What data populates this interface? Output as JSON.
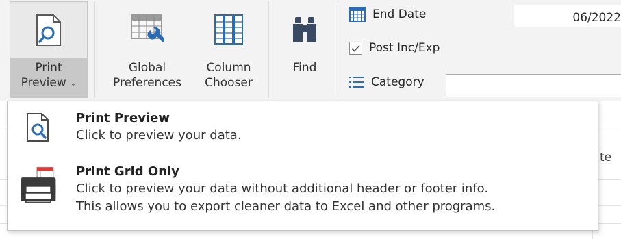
{
  "ribbon": {
    "print_preview": {
      "line1": "Print",
      "line2": "Preview",
      "chevron": "⌄"
    },
    "global_preferences": {
      "line1": "Global",
      "line2": "Preferences"
    },
    "column_chooser": {
      "line1": "Column",
      "line2": "Chooser"
    },
    "find": {
      "label": "Find"
    },
    "end_date": {
      "label": "End Date",
      "value": "06/2022"
    },
    "post_inc_exp": {
      "label": "Post Inc/Exp",
      "checked": true
    },
    "category": {
      "label": "Category",
      "value": ""
    }
  },
  "grid": {
    "header_fragment": "te"
  },
  "dropdown": {
    "items": [
      {
        "title": "Print Preview",
        "desc": [
          "Click to preview your data."
        ],
        "icon": "print-preview-icon"
      },
      {
        "title": "Print Grid Only",
        "desc": [
          "Click to preview your data without additional header or footer info.",
          "This allows you to export cleaner data to Excel and other programs."
        ],
        "icon": "printer-icon"
      }
    ]
  },
  "colors": {
    "accent_blue": "#2b6cb5",
    "printer_red": "#e53935",
    "dark_gray": "#3a3a3a"
  }
}
